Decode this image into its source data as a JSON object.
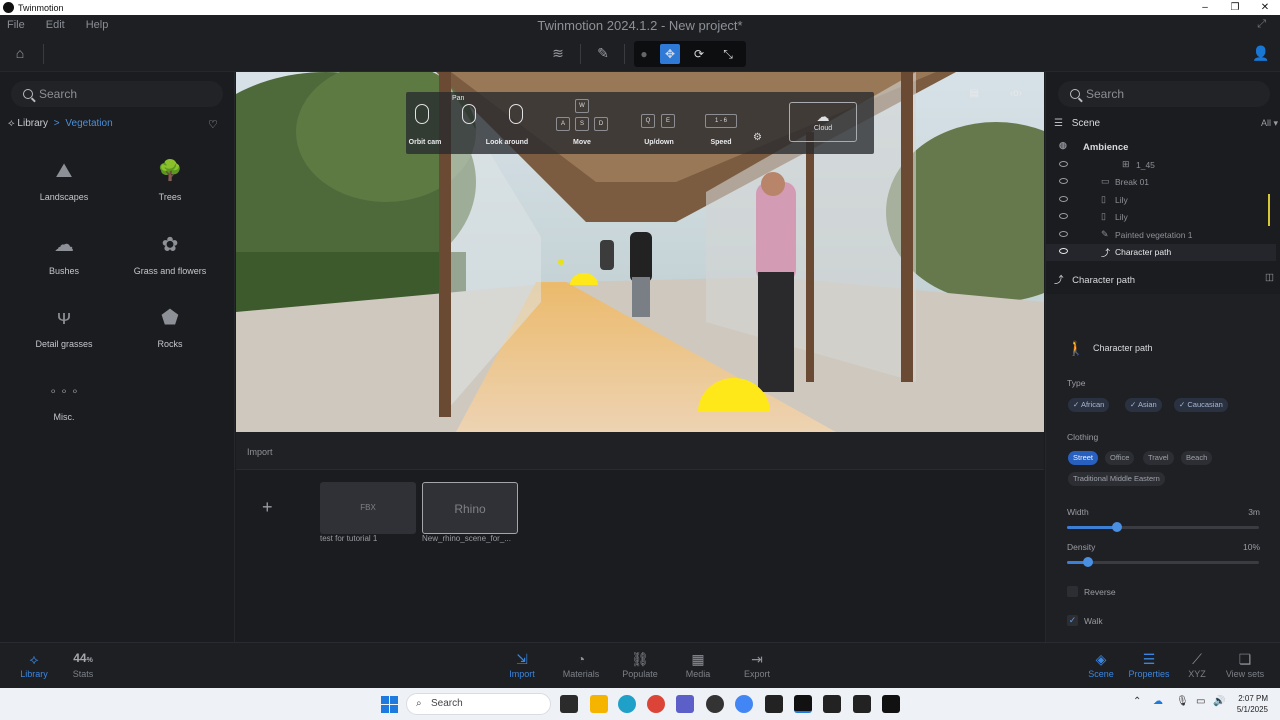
{
  "window": {
    "app_name": "Twinmotion",
    "title": "Twinmotion 2024.1.2 - New project*"
  },
  "menu": [
    "File",
    "Edit",
    "Help"
  ],
  "left": {
    "search_placeholder": "Search",
    "breadcrumb": {
      "root": "Library",
      "separator": ">",
      "current": "Vegetation"
    },
    "categories": [
      {
        "label": "Landscapes",
        "icon": "landscape-icon"
      },
      {
        "label": "Trees",
        "icon": "tree-icon"
      },
      {
        "label": "Bushes",
        "icon": "bush-icon"
      },
      {
        "label": "Grass and flowers",
        "icon": "grass-flowers-icon"
      },
      {
        "label": "Detail grasses",
        "icon": "detail-grass-icon"
      },
      {
        "label": "Rocks",
        "icon": "rock-icon"
      },
      {
        "label": "Misc.",
        "icon": "more-dots-icon"
      }
    ]
  },
  "viewport_hud": {
    "pan": "Pan",
    "orbit": "Orbit cam",
    "look": "Look around",
    "move": "Move",
    "updown": "Up/down",
    "speed": "Speed",
    "speed_range": "1 - 6",
    "cloud": "Cloud",
    "keys": {
      "w": "W",
      "a": "A",
      "s": "S",
      "d": "D",
      "q": "Q",
      "e": "E"
    }
  },
  "import": {
    "title": "Import",
    "tiles": [
      {
        "badge": "FBX",
        "caption": "test for tutorial 1"
      },
      {
        "badge": "Rhino",
        "caption": "New_rhino_scene_for_..."
      }
    ]
  },
  "right": {
    "search_placeholder": "Search",
    "scene_label": "Scene",
    "filter": "All",
    "tree": [
      {
        "label": "Ambience",
        "icon": "globe-icon"
      },
      {
        "label": "1_45",
        "icon": "hierarchy-icon"
      },
      {
        "label": "Break 01",
        "icon": "object-icon"
      },
      {
        "label": "Lily",
        "icon": "document-icon"
      },
      {
        "label": "Lily",
        "icon": "document-icon"
      },
      {
        "label": "Painted vegetation 1",
        "icon": "brush-icon"
      },
      {
        "label": "Character path",
        "icon": "path-icon"
      }
    ],
    "props": {
      "header": "Character path",
      "card_title": "Character path",
      "type_label": "Type",
      "types": [
        "African",
        "Asian",
        "Caucasian"
      ],
      "clothing_label": "Clothing",
      "clothing": [
        "Street",
        "Office",
        "Travel",
        "Beach",
        "Traditional Middle Eastern"
      ],
      "clothing_selected": "Street",
      "width_label": "Width",
      "width_value": "3m",
      "width_fraction": 0.26,
      "density_label": "Density",
      "density_value": "10%",
      "density_fraction": 0.11,
      "reverse_label": "Reverse",
      "reverse_checked": false,
      "walk_label": "Walk",
      "walk_checked": true
    }
  },
  "bottom": {
    "left": [
      {
        "label": "Library",
        "icon": "library-icon",
        "active": true
      },
      {
        "label": "Stats",
        "value": "44",
        "unit": "%",
        "active": false
      }
    ],
    "center": [
      {
        "label": "Import",
        "icon": "import-icon",
        "active": true
      },
      {
        "label": "Materials",
        "icon": "materials-icon",
        "active": false
      },
      {
        "label": "Populate",
        "icon": "populate-icon",
        "active": false
      },
      {
        "label": "Media",
        "icon": "media-icon",
        "active": false
      },
      {
        "label": "Export",
        "icon": "export-icon",
        "active": false
      }
    ],
    "right": [
      {
        "label": "Scene",
        "icon": "scene-icon",
        "active": true
      },
      {
        "label": "Properties",
        "icon": "properties-icon",
        "active": true
      },
      {
        "label": "XYZ",
        "icon": "xyz-icon",
        "active": false
      },
      {
        "label": "View sets",
        "icon": "viewsets-icon",
        "active": false
      }
    ]
  },
  "taskbar": {
    "search": "Search",
    "time": "2:07 PM",
    "date": "5/1/2025"
  },
  "colors": {
    "accent": "#2f7ad6",
    "highlight": "#d8c63a",
    "panel": "#1b1c20"
  }
}
